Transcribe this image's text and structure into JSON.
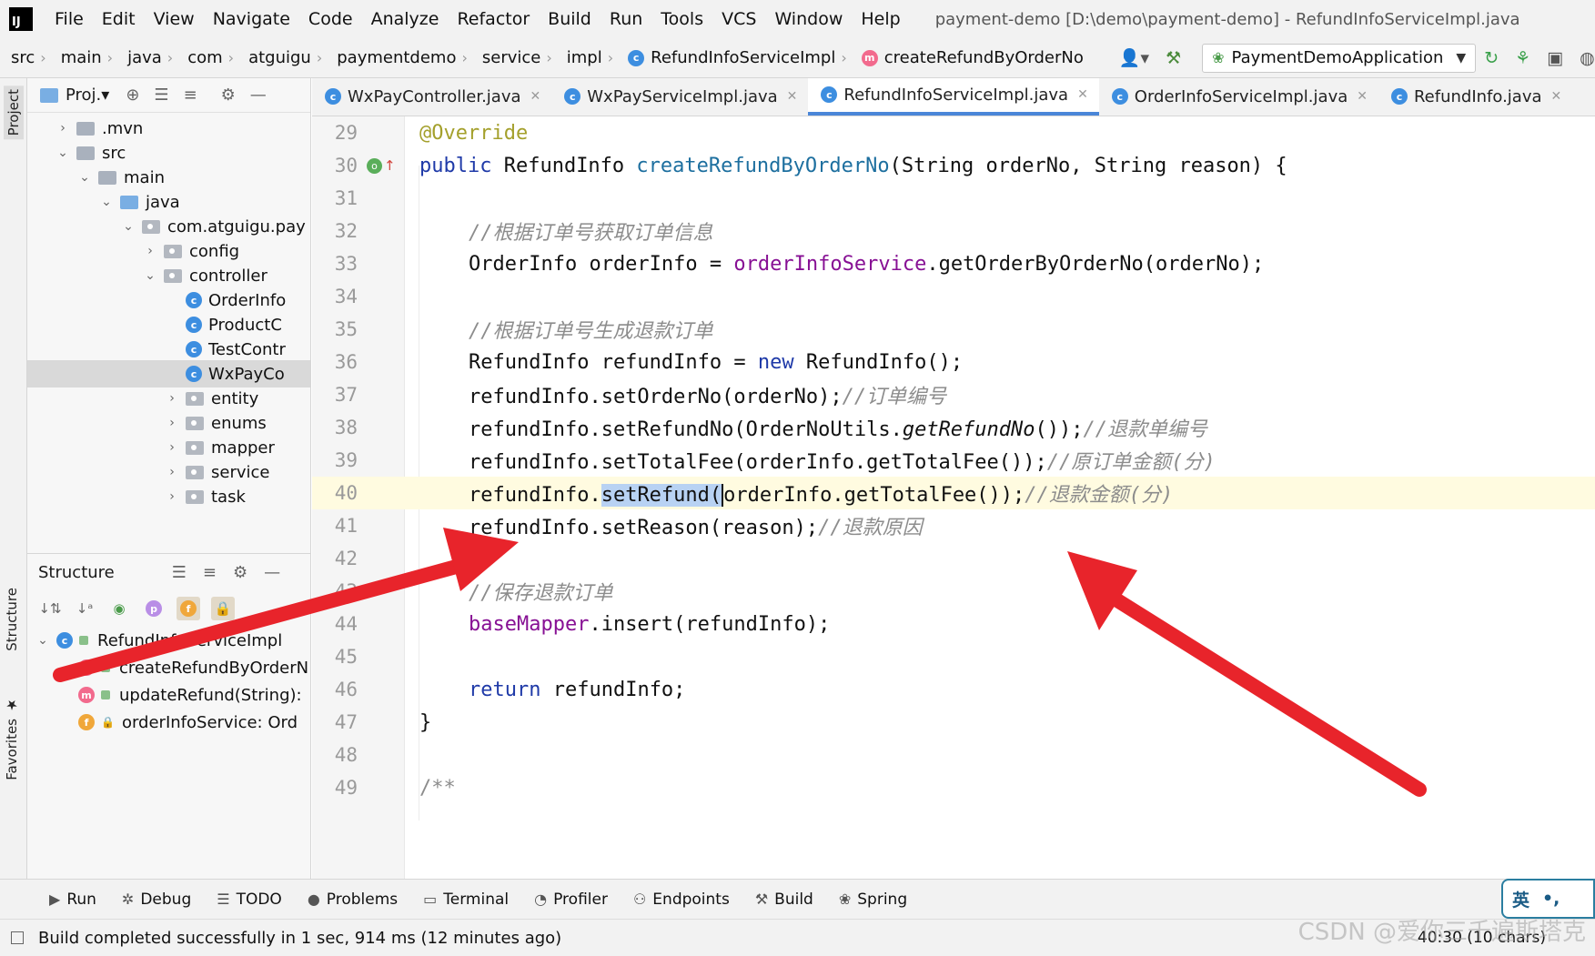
{
  "menubar": {
    "logo": "IJ",
    "items": [
      "File",
      "Edit",
      "View",
      "Navigate",
      "Code",
      "Analyze",
      "Refactor",
      "Build",
      "Run",
      "Tools",
      "VCS",
      "Window",
      "Help"
    ],
    "window_title": "payment-demo [D:\\demo\\payment-demo] - RefundInfoServiceImpl.java"
  },
  "breadcrumb": [
    "src",
    "main",
    "java",
    "com",
    "atguigu",
    "paymentdemo",
    "service",
    "impl",
    "RefundInfoServiceImpl",
    "createRefundByOrderNo"
  ],
  "run_config": "PaymentDemoApplication",
  "left_strip": {
    "project": "Project",
    "structure": "Structure",
    "favorites": "Favorites"
  },
  "project_panel": {
    "title": "Proj.▾",
    "tree": [
      {
        "label": ".mvn",
        "expanded": false
      },
      {
        "label": "src",
        "expanded": true
      },
      {
        "label": "main",
        "expanded": true
      },
      {
        "label": "java",
        "expanded": true
      },
      {
        "label": "com.atguigu.pay",
        "expanded": true
      },
      {
        "label": "config",
        "expanded": false
      },
      {
        "label": "controller",
        "expanded": true
      },
      {
        "label": "OrderInfo"
      },
      {
        "label": "ProductC"
      },
      {
        "label": "TestContr"
      },
      {
        "label": "WxPayCo"
      },
      {
        "label": "entity",
        "expanded": false
      },
      {
        "label": "enums",
        "expanded": false
      },
      {
        "label": "mapper",
        "expanded": false
      },
      {
        "label": "service",
        "expanded": false
      },
      {
        "label": "task",
        "expanded": false
      }
    ]
  },
  "structure_panel": {
    "title": "Structure",
    "items": [
      {
        "label": "RefundInfoServiceImpl"
      },
      {
        "label": "createRefundByOrderN"
      },
      {
        "label": "updateRefund(String):"
      },
      {
        "label": "orderInfoService: Ord"
      }
    ]
  },
  "editor_tabs": [
    {
      "label": "WxPayController.java",
      "active": false
    },
    {
      "label": "WxPayServiceImpl.java",
      "active": false
    },
    {
      "label": "RefundInfoServiceImpl.java",
      "active": true
    },
    {
      "label": "OrderInfoServiceImpl.java",
      "active": false
    },
    {
      "label": "RefundInfo.java",
      "active": false
    }
  ],
  "editor": {
    "line_numbers": [
      "29",
      "30",
      "31",
      "32",
      "33",
      "34",
      "35",
      "36",
      "37",
      "38",
      "39",
      "40",
      "41",
      "42",
      "43",
      "44",
      "45",
      "46",
      "47",
      "48",
      "49"
    ],
    "code": {
      "l29": "@Override",
      "l30_a": "public ",
      "l30_b": "RefundInfo ",
      "l30_c": "createRefundByOrderNo",
      "l30_d": "(String orderNo, String reason) {",
      "l32": "//根据订单号获取订单信息",
      "l33_a": "OrderInfo orderInfo = ",
      "l33_b": "orderInfoService",
      "l33_c": ".getOrderByOrderNo(orderNo);",
      "l35": "//根据订单号生成退款订单",
      "l36_a": "RefundInfo refundInfo = ",
      "l36_b": "new",
      "l36_c": " RefundInfo();",
      "l37_a": "refundInfo.setOrderNo(orderNo);",
      "l37_b": "//订单编号",
      "l38_a": "refundInfo.setRefundNo(OrderNoUtils.",
      "l38_b": "getRefundNo",
      "l38_c": "());",
      "l38_d": "//退款单编号",
      "l39_a": "refundInfo.setTotalFee(orderInfo.getTotalFee());",
      "l39_b": "//原订单金额(分)",
      "l40_a": "refundInfo.",
      "l40_b": "setRefund(",
      "l40_c": "orderInfo.getTotalFee());",
      "l40_d": "//退款金额(分)",
      "l41_a": "refundInfo.setReason(reason);",
      "l41_b": "//退款原因",
      "l43": "//保存退款订单",
      "l44_a": "baseMapper",
      "l44_b": ".insert(refundInfo);",
      "l46_a": "return",
      "l46_b": " refundInfo;",
      "l47": "}",
      "l49": "/**"
    }
  },
  "bottom_tools": [
    "Run",
    "Debug",
    "TODO",
    "Problems",
    "Terminal",
    "Profiler",
    "Endpoints",
    "Build",
    "Spring"
  ],
  "status": {
    "message": "Build completed successfully in 1 sec, 914 ms (12 minutes ago)",
    "caret": "40:30 (10 chars)"
  },
  "ime": {
    "lang": "英",
    "punct": "•,"
  },
  "watermark": "CSDN @爱你三千遍斯塔克",
  "colors": {
    "accent": "#4a86d8",
    "annotation_arrows": "#e8242b",
    "keyword": "#1f3aa8",
    "field": "#871094",
    "comment": "#8c8c8c"
  },
  "icons": [
    "app-logo-icon",
    "class-icon",
    "method-icon",
    "folder-icon",
    "package-icon",
    "gear-icon",
    "locate-icon",
    "expand-all-icon",
    "collapse-all-icon",
    "minimize-icon",
    "override-icon",
    "run-icon",
    "bug-icon",
    "hammer-icon"
  ]
}
